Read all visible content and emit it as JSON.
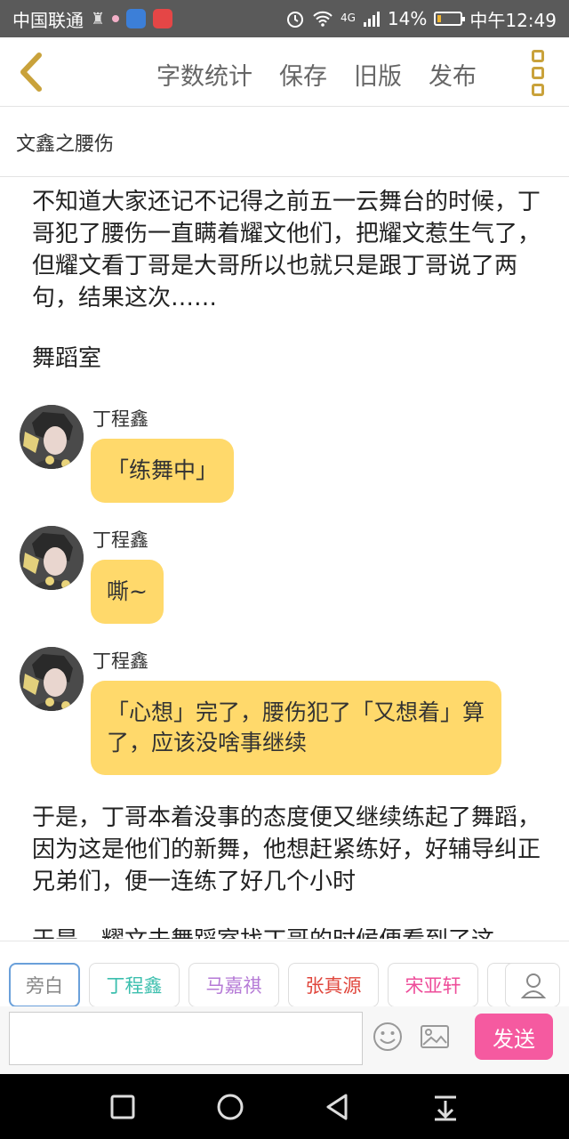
{
  "status_bar": {
    "carrier": "中国联通",
    "network": "4G",
    "battery": "14%",
    "battery_level": 0.14,
    "time": "中午12:49"
  },
  "toolbar": {
    "back_icon": "chevron-left-icon",
    "word_count_label": "字数统计",
    "save_label": "保存",
    "old_version_label": "旧版",
    "publish_label": "发布",
    "more_icon": "more-vertical-icon",
    "accent_color": "#c9a23b"
  },
  "doc_title": "文鑫之腰伤",
  "content": {
    "intro": "不知道大家还记不记得之前五一云舞台的时候，丁哥犯了腰伤一直瞒着耀文他们，把耀文惹生气了，但耀文看丁哥是大哥所以也就只是跟丁哥说了两句，结果这次……",
    "scene": "舞蹈室",
    "messages": [
      {
        "speaker": "丁程鑫",
        "text": "「练舞中」"
      },
      {
        "speaker": "丁程鑫",
        "text": "嘶~"
      },
      {
        "speaker": "丁程鑫",
        "text": "「心想」完了，腰伤犯了「又想着」算了，应该没啥事继续"
      }
    ],
    "para2": "于是，丁哥本着没事的态度便又继续练起了舞蹈，因为这是他们的新舞，他想赶紧练好，好辅导纠正兄弟们，便一连练了好几个小时",
    "para3": "于是，耀文去舞蹈室找丁哥的时候便看到了这"
  },
  "roles": [
    {
      "label": "旁白",
      "color": "#888888"
    },
    {
      "label": "丁程鑫",
      "color": "#3cbfae"
    },
    {
      "label": "马嘉祺",
      "color": "#b57ad6"
    },
    {
      "label": "张真源",
      "color": "#e0463c"
    },
    {
      "label": "宋亚轩",
      "color": "#ee4d9a"
    }
  ],
  "input": {
    "placeholder": "",
    "emoji_icon": "emoji-icon",
    "image_icon": "image-icon",
    "send_label": "发送",
    "send_color": "#f55aa0"
  },
  "nav": {
    "recents_icon": "square-icon",
    "home_icon": "circle-icon",
    "back_icon": "triangle-back-icon",
    "notifications_icon": "pull-down-icon"
  },
  "bubble_color": "#ffd96b"
}
